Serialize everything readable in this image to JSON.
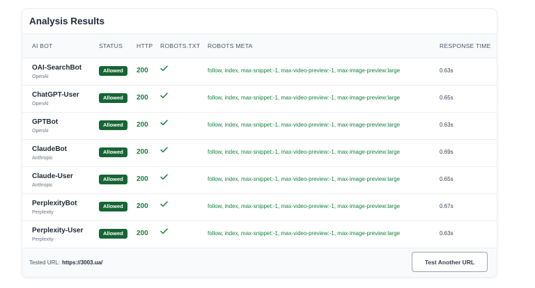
{
  "title": "Analysis Results",
  "columns": {
    "bot": "AI BOT",
    "status": "STATUS",
    "http": "HTTP",
    "robots_txt": "ROBOTS.TXT",
    "robots_meta": "ROBOTS META",
    "response_time": "RESPONSE TIME"
  },
  "rows": [
    {
      "bot": "OAI-SearchBot",
      "vendor": "OpenAI",
      "status": "Allowed",
      "http": "200",
      "robots_txt_icon": "check-icon",
      "meta": "follow, index, max-snippet:-1, max-video-preview:-1, max-image-preview:large",
      "time": "0.63s"
    },
    {
      "bot": "ChatGPT-User",
      "vendor": "OpenAI",
      "status": "Allowed",
      "http": "200",
      "robots_txt_icon": "check-icon",
      "meta": "follow, index, max-snippet:-1, max-video-preview:-1, max-image-preview:large",
      "time": "0.65s"
    },
    {
      "bot": "GPTBot",
      "vendor": "OpenAI",
      "status": "Allowed",
      "http": "200",
      "robots_txt_icon": "check-icon",
      "meta": "follow, index, max-snippet:-1, max-video-preview:-1, max-image-preview:large",
      "time": "0.63s"
    },
    {
      "bot": "ClaudeBot",
      "vendor": "Anthropic",
      "status": "Allowed",
      "http": "200",
      "robots_txt_icon": "check-icon",
      "meta": "follow, index, max-snippet:-1, max-video-preview:-1, max-image-preview:large",
      "time": "0.69s"
    },
    {
      "bot": "Claude-User",
      "vendor": "Anthropic",
      "status": "Allowed",
      "http": "200",
      "robots_txt_icon": "check-icon",
      "meta": "follow, index, max-snippet:-1, max-video-preview:-1, max-image-preview:large",
      "time": "0.65s"
    },
    {
      "bot": "PerplexityBot",
      "vendor": "Perplexity",
      "status": "Allowed",
      "http": "200",
      "robots_txt_icon": "check-icon",
      "meta": "follow, index, max-snippet:-1, max-video-preview:-1, max-image-preview:large",
      "time": "0.67s"
    },
    {
      "bot": "Perplexity-User",
      "vendor": "Perplexity",
      "status": "Allowed",
      "http": "200",
      "robots_txt_icon": "check-icon",
      "meta": "follow, index, max-snippet:-1, max-video-preview:-1, max-image-preview:large",
      "time": "0.63s"
    }
  ],
  "footer": {
    "tested_label": "Tested URL:",
    "tested_url": "https://3003.ua/",
    "button_label": "Test Another URL"
  },
  "colors": {
    "allowed_badge": "#166534",
    "success_text": "#15803d"
  }
}
